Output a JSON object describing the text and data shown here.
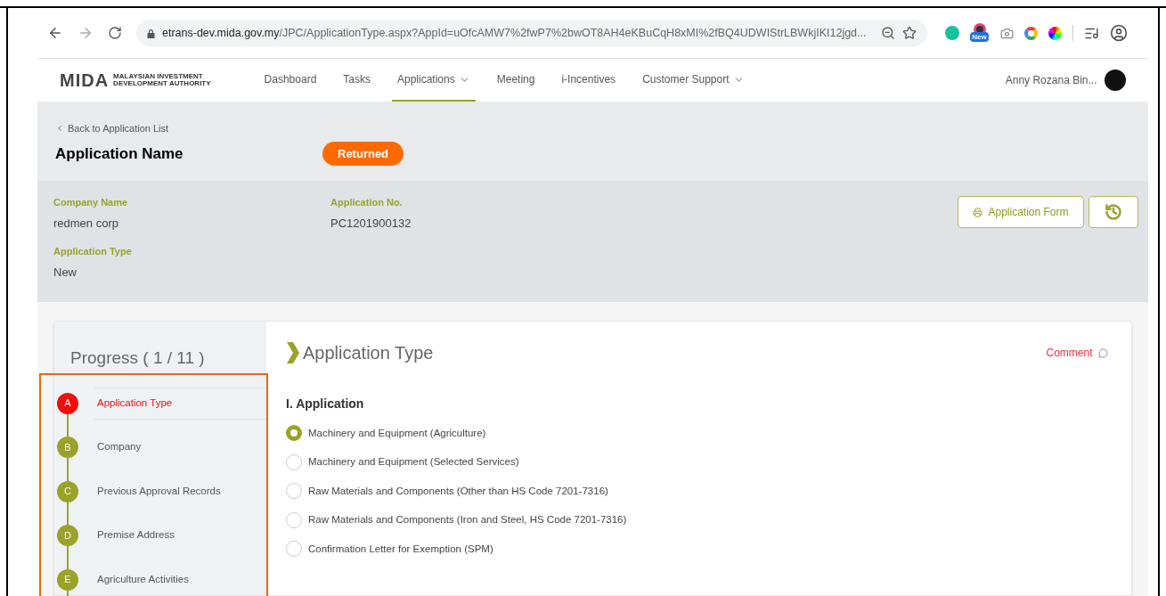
{
  "browser": {
    "url_host": "etrans-dev.mida.gov.my",
    "url_path": "/JPC/ApplicationType.aspx?AppId=uOfcAMW7%2fwP7%2bwOT8AH4eKBuCqH8xMI%2fBQ4UDWIStrLBWkjIKI12jgd...",
    "extension_badge": "New"
  },
  "logo": {
    "mark": "MIDA",
    "line_1": "MALAYSIAN INVESTMENT",
    "line_2": "DEVELOPMENT AUTHORITY"
  },
  "nav": [
    {
      "label": "Dashboard",
      "selected": false,
      "dropdown": false
    },
    {
      "label": "Tasks",
      "selected": false,
      "dropdown": false
    },
    {
      "label": "Applications",
      "selected": true,
      "dropdown": true
    },
    {
      "label": "Meeting",
      "selected": false,
      "dropdown": false
    },
    {
      "label": "i-Incentives",
      "selected": false,
      "dropdown": false
    },
    {
      "label": "Customer Support",
      "selected": false,
      "dropdown": true
    }
  ],
  "user": {
    "name": "Anny Rozana Bin..."
  },
  "header": {
    "back_link": "Back to Application List",
    "title": "Application Name",
    "status": "Returned"
  },
  "info": [
    {
      "label": "Company Name",
      "value": "redmen corp"
    },
    {
      "label": "Application No.",
      "value": "PC1201900132"
    },
    {
      "label": "Application Type",
      "value": "New"
    }
  ],
  "actions": {
    "form_button": "Application Form"
  },
  "progress": {
    "title": "Progress ( 1 / 11 )",
    "steps": [
      {
        "letter": "A",
        "label": "Application Type",
        "selected": true
      },
      {
        "letter": "B",
        "label": "Company",
        "selected": false
      },
      {
        "letter": "C",
        "label": "Previous Approval Records",
        "selected": false
      },
      {
        "letter": "D",
        "label": "Premise Address",
        "selected": false
      },
      {
        "letter": "E",
        "label": "Agriculture Activities",
        "selected": false
      }
    ]
  },
  "content": {
    "title": "Application Type",
    "comment": "Comment",
    "section": "I. Application",
    "options": [
      {
        "label": "Machinery and Equipment (Agriculture)",
        "selected": true
      },
      {
        "label": "Machinery and Equipment (Selected Services)",
        "selected": false
      },
      {
        "label": "Raw Materials and Components (Other than HS Code 7201-7316)",
        "selected": false
      },
      {
        "label": "Raw Materials and Components (Iron and Steel, HS Code 7201-7316)",
        "selected": false
      },
      {
        "label": "Confirmation Letter for Exemption (SPM)",
        "selected": false
      }
    ]
  }
}
